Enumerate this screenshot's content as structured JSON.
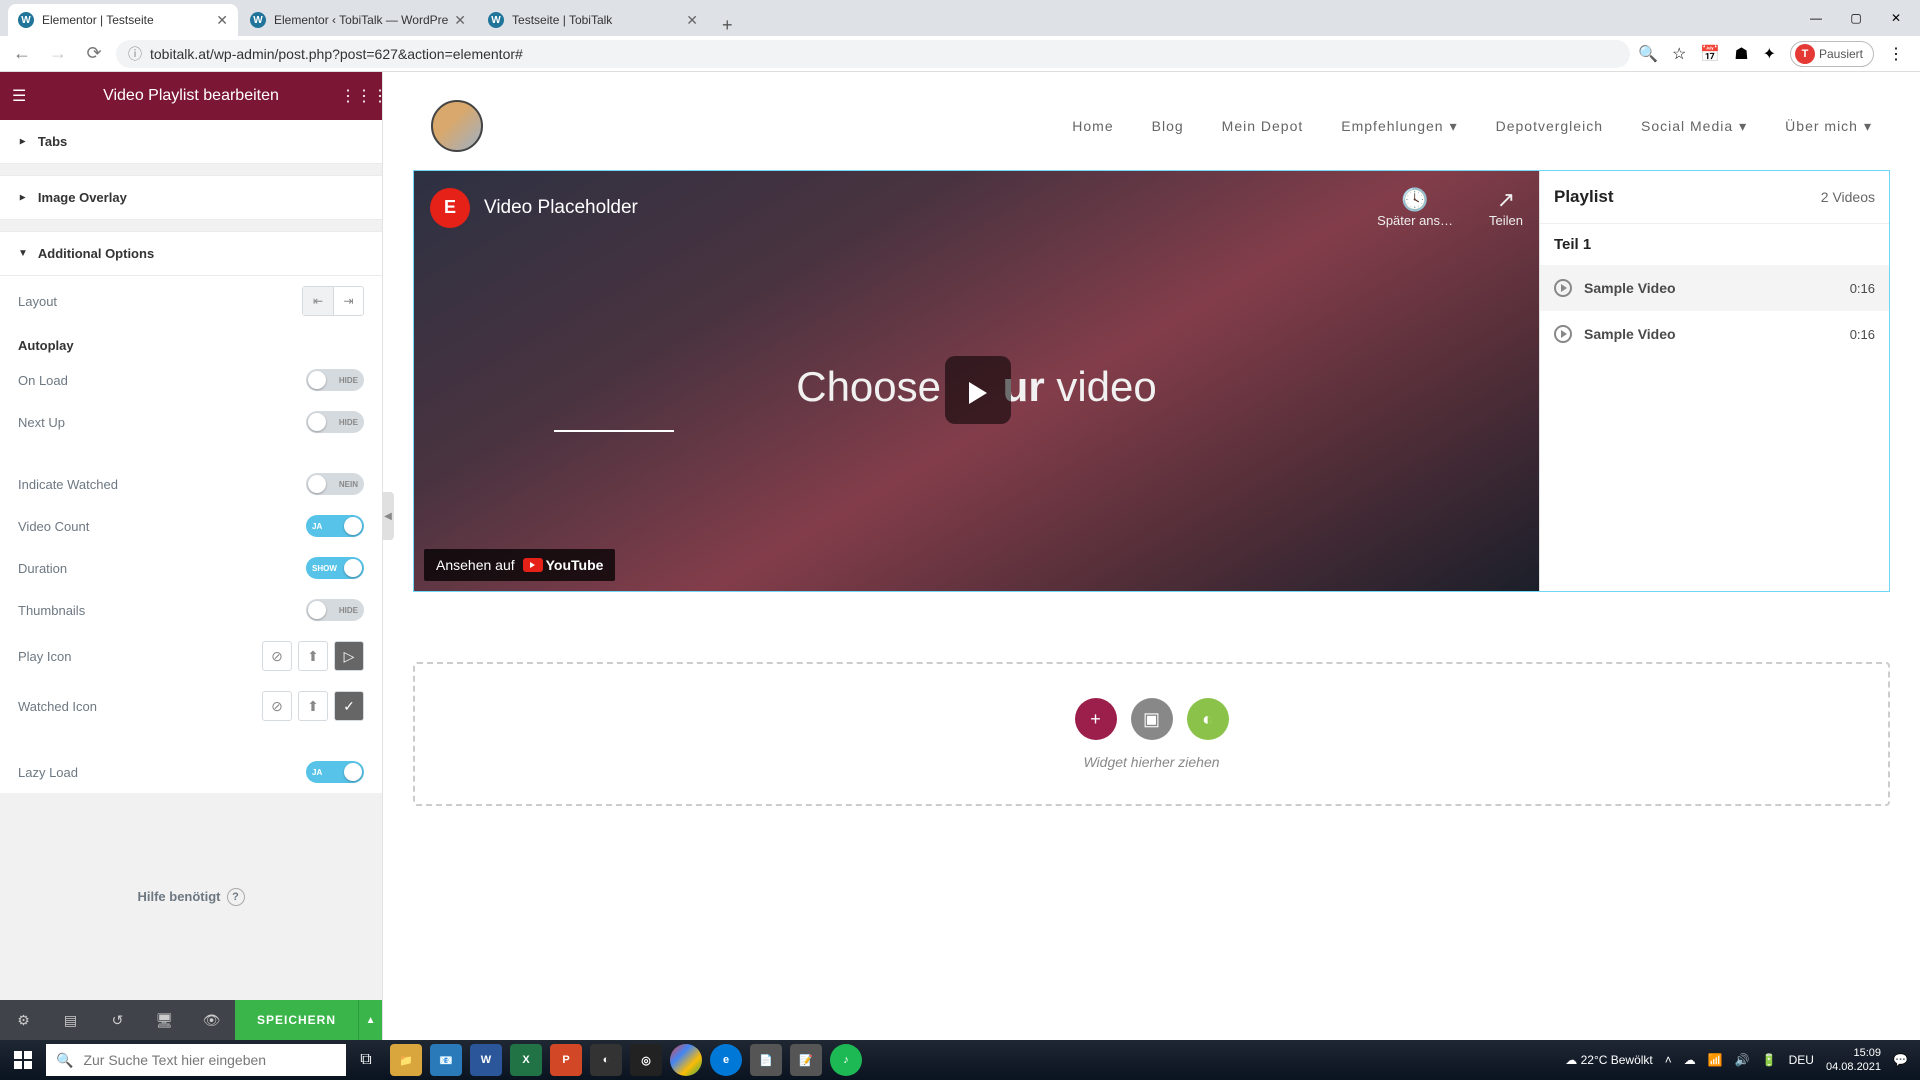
{
  "browser": {
    "tabs": [
      {
        "title": "Elementor | Testseite"
      },
      {
        "title": "Elementor ‹ TobiTalk — WordPre"
      },
      {
        "title": "Testseite | TobiTalk"
      }
    ],
    "url": "tobitalk.at/wp-admin/post.php?post=627&action=elementor#",
    "profile_status": "Pausiert"
  },
  "elementor": {
    "header_title": "Video Playlist bearbeiten",
    "sections": {
      "tabs": "Tabs",
      "image_overlay": "Image Overlay",
      "additional_options": "Additional Options"
    },
    "controls": {
      "layout": "Layout",
      "autoplay": "Autoplay",
      "on_load": "On Load",
      "next_up": "Next Up",
      "indicate_watched": "Indicate Watched",
      "video_count": "Video Count",
      "duration": "Duration",
      "thumbnails": "Thumbnails",
      "play_icon": "Play Icon",
      "watched_icon": "Watched Icon",
      "lazy_load": "Lazy Load"
    },
    "toggle_labels": {
      "hide": "HIDE",
      "show": "SHOW",
      "ja": "JA",
      "nein": "NEIN"
    },
    "help": "Hilfe benötigt",
    "footer": {
      "save": "SPEICHERN"
    }
  },
  "site_nav": {
    "items": [
      "Home",
      "Blog",
      "Mein Depot",
      "Empfehlungen",
      "Depotvergleich",
      "Social Media",
      "Über mich"
    ]
  },
  "video": {
    "title": "Video Placeholder",
    "overlay_text_1": "Choose ",
    "overlay_text_2": "ur",
    "overlay_text_3": " video",
    "watch_later": "Später ans…",
    "share": "Teilen",
    "watch_on": "Ansehen auf",
    "youtube": "YouTube"
  },
  "playlist": {
    "title": "Playlist",
    "count": "2 Videos",
    "part": "Teil 1",
    "items": [
      {
        "title": "Sample Video",
        "duration": "0:16"
      },
      {
        "title": "Sample Video",
        "duration": "0:16"
      }
    ]
  },
  "dropzone": {
    "text": "Widget hierher ziehen"
  },
  "taskbar": {
    "search_placeholder": "Zur Suche Text hier eingeben",
    "weather": "22°C  Bewölkt",
    "lang": "DEU",
    "time": "15:09",
    "date": "04.08.2021"
  }
}
